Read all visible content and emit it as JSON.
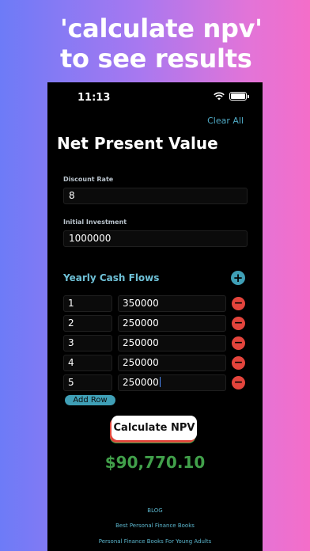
{
  "headline": {
    "line1": "'calculate npv'",
    "line2": "to see results"
  },
  "status_bar": {
    "time": "11:13",
    "icons": [
      "wifi-icon",
      "battery-icon"
    ]
  },
  "header": {
    "clear_all": "Clear All",
    "title": "Net Present Value"
  },
  "fields": {
    "discount_rate": {
      "label": "Discount Rate",
      "value": "8"
    },
    "initial_investment": {
      "label": "Initial Investment",
      "value": "1000000"
    }
  },
  "cash_flows": {
    "title": "Yearly Cash Flows",
    "add_icon": "+",
    "remove_icon": "−",
    "rows": [
      {
        "year": "1",
        "amount": "350000"
      },
      {
        "year": "2",
        "amount": "250000"
      },
      {
        "year": "3",
        "amount": "250000"
      },
      {
        "year": "4",
        "amount": "250000"
      },
      {
        "year": "5",
        "amount": "250000"
      }
    ],
    "add_row_label": "Add Row"
  },
  "calculate_label": "Calculate NPV",
  "result": "$90,770.10",
  "footer_links": [
    "BLOG",
    "Best Personal Finance Books",
    "Personal Finance Books For Young Adults"
  ],
  "colors": {
    "accent": "#3f9fb6",
    "remove": "#e3443c",
    "result": "#41a04a"
  }
}
